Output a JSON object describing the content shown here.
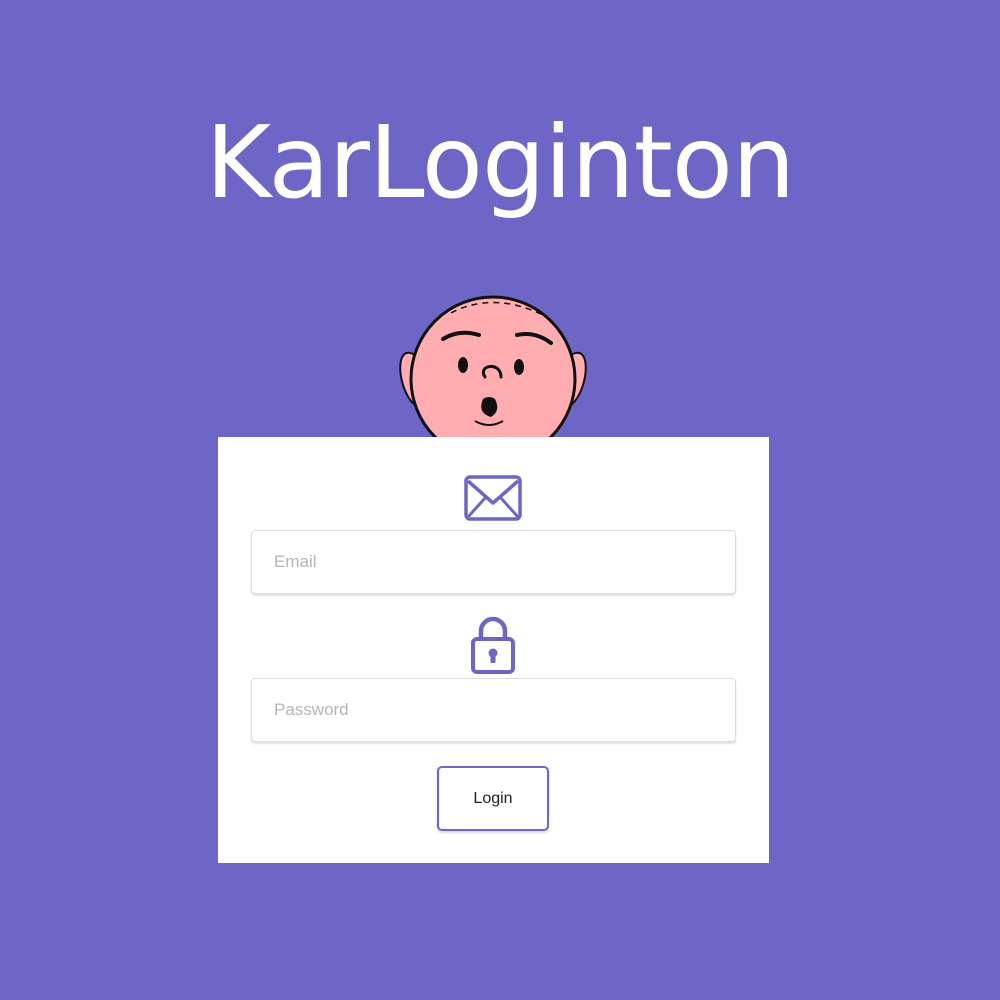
{
  "app": {
    "title": "KarLoginton"
  },
  "login_form": {
    "email": {
      "placeholder": "Email",
      "value": "",
      "icon": "envelope-icon"
    },
    "password": {
      "placeholder": "Password",
      "value": "",
      "icon": "lock-icon"
    },
    "submit_label": "Login"
  },
  "mascot": {
    "icon": "bald-cartoon-head"
  },
  "colors": {
    "background": "#6e66c7",
    "accent": "#6e66c7",
    "card": "#ffffff",
    "mascot_skin": "#ffadb0",
    "title_text": "#ffffff"
  }
}
